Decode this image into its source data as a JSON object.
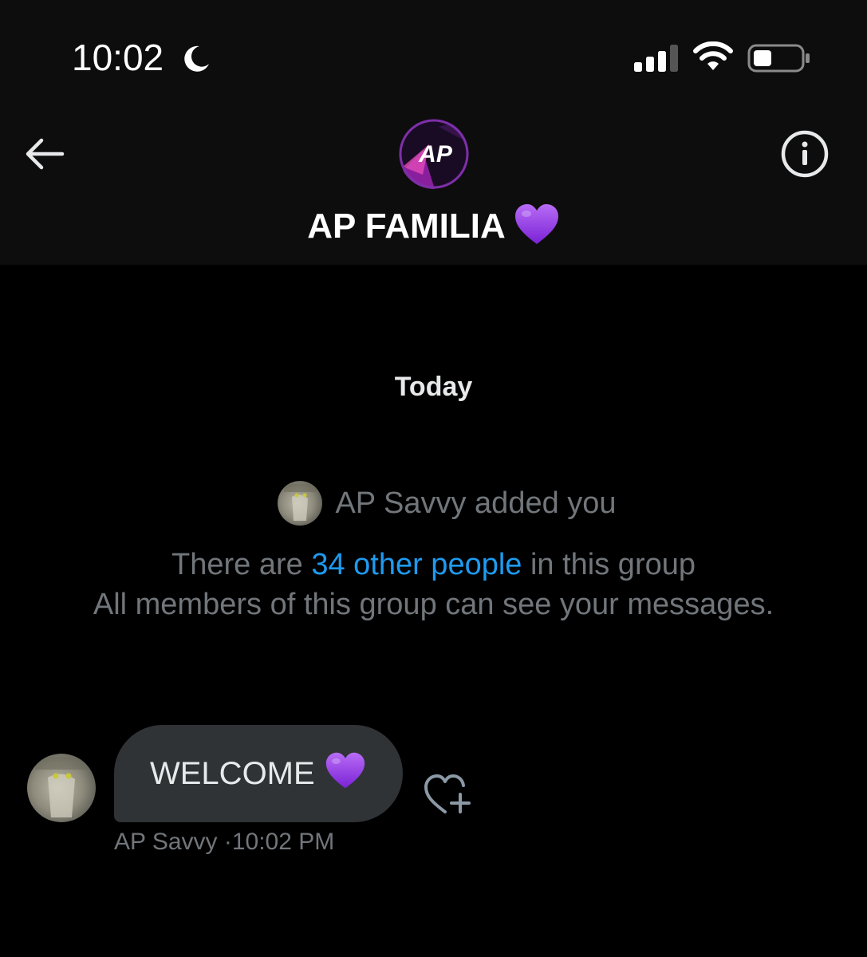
{
  "status_bar": {
    "time": "10:02",
    "icons": [
      "moon-icon",
      "signal-icon",
      "wifi-icon",
      "battery-icon"
    ]
  },
  "header": {
    "back_icon": "arrow-left-icon",
    "avatar_logo": "AP",
    "title": "AP FAMILIA",
    "title_emoji": "purple-heart-icon",
    "info_icon": "info-icon"
  },
  "chat": {
    "date_separator": "Today",
    "system_added": "AP Savvy added you",
    "members_prefix": "There are ",
    "members_link": "34 other people",
    "members_suffix": " in this group",
    "visibility_notice": "All members of this group can see your messages.",
    "messages": [
      {
        "text": "WELCOME",
        "emoji": "purple-heart-icon",
        "sender": "AP Savvy",
        "time": "10:02 PM"
      }
    ]
  },
  "colors": {
    "background": "#000000",
    "header_bg": "#0d0d0d",
    "bubble_bg": "#2f3336",
    "muted_text": "#71767b",
    "link": "#1d9bf0",
    "heart": "#9b3dea"
  }
}
